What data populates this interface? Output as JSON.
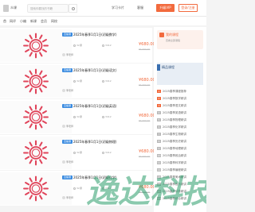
{
  "header": {
    "brand": "众课",
    "search_placeholder": "搜索你要找的书籍",
    "link1": "学习卡片",
    "link2": "客服",
    "open_button": "升级VIP",
    "login_button": "登录/注册"
  },
  "nav": [
    "首",
    "网评",
    "小编",
    "新课",
    "会员",
    "网校"
  ],
  "courses": [
    {
      "tag": "直播课",
      "title": "2025年春季1月1日(初级数学)",
      "lessons": "32课",
      "students": "3412",
      "price": "¥680.00",
      "old": "¥1200.00",
      "teacher": "李老师"
    },
    {
      "tag": "直播课",
      "title": "2025年春季1月1日(初级语文)",
      "lessons": "32课",
      "students": "3412",
      "price": "¥680.00",
      "old": "¥1200.00",
      "teacher": "李老师"
    },
    {
      "tag": "直播课",
      "title": "2025年春季1月1日(初级英语)",
      "lessons": "32课",
      "students": "3412",
      "price": "¥680.00",
      "old": "¥1200.00",
      "teacher": "李老师"
    },
    {
      "tag": "直播课",
      "title": "2025年春季1月1日(初级物理)",
      "lessons": "32课",
      "students": "3412",
      "price": "¥680.00",
      "old": "¥1200.00",
      "teacher": "李老师"
    },
    {
      "tag": "直播课",
      "title": "2025年春季1月1日(初级化学)",
      "lessons": "32课",
      "students": "3412",
      "price": "¥680.00",
      "old": "¥1200.00",
      "teacher": "李老师"
    }
  ],
  "sidebar": {
    "card_title": "我的课程",
    "card_sub": "查看全部课程",
    "banner_label": "精品课程",
    "items": [
      {
        "rank": "1",
        "text": "2025春季课程推荐"
      },
      {
        "rank": "2",
        "text": "2025春季数学精讲"
      },
      {
        "rank": "3",
        "text": "2025春季语文精讲"
      },
      {
        "rank": "4",
        "text": "2025春季英语精讲"
      },
      {
        "rank": "5",
        "text": "2025春季物理精讲"
      },
      {
        "rank": "6",
        "text": "2025春季化学精讲"
      },
      {
        "rank": "7",
        "text": "2025春季生物精讲"
      },
      {
        "rank": "8",
        "text": "2025春季历史精讲"
      },
      {
        "rank": "9",
        "text": "2025春季地理精讲"
      },
      {
        "rank": "10",
        "text": "2025春季政治精讲"
      },
      {
        "rank": "11",
        "text": "2025春季科学精讲"
      },
      {
        "rank": "12",
        "text": "2025春季编程精讲"
      },
      {
        "rank": "13",
        "text": "2025春季美术精讲"
      },
      {
        "rank": "14",
        "text": "2025春季音乐精讲"
      },
      {
        "rank": "15",
        "text": "2025春季体育精讲"
      },
      {
        "rank": "16",
        "text": "2025春季综合精讲"
      }
    ]
  },
  "watermark": "逸达科技",
  "colors": {
    "accent": "#f26a3d",
    "tag": "#3a8be0",
    "sun": "#e0445a"
  }
}
